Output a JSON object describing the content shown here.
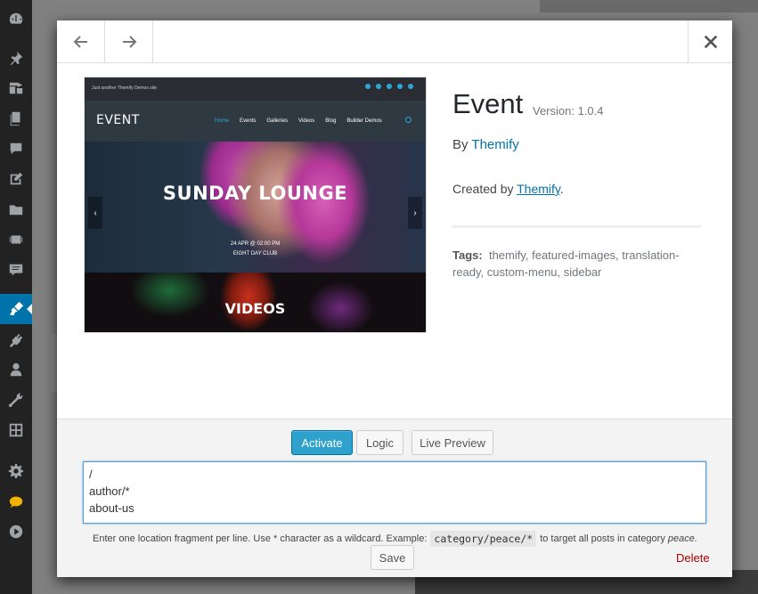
{
  "admin_menu": {
    "icons": [
      "dashboard-icon",
      "pin-icon",
      "media-icon",
      "pages-icon",
      "comments-icon",
      "edit-icon",
      "folder-icon",
      "slider-icon",
      "feedback-icon",
      "appearance-icon",
      "plugins-icon",
      "users-icon",
      "tools-icon",
      "settings-grid-icon",
      "gear-icon",
      "bubble-icon",
      "play-icon"
    ]
  },
  "modal": {
    "header": {
      "prev_icon": "arrow-left-icon",
      "next_icon": "arrow-right-icon",
      "close_icon": "close-icon"
    },
    "screenshot": {
      "tagline": "Just another Themify Demos site",
      "logo": "EVENT",
      "menu": [
        "Home",
        "Events",
        "Galleries",
        "Videos",
        "Blog",
        "Builder Demos"
      ],
      "hero_title": "SUNDAY LOUNGE",
      "hero_date": "24 APR @ 02:00 PM",
      "hero_venue": "EIGHT DAY CLUB",
      "videos_title": "VIDEOS"
    },
    "theme": {
      "name": "Event",
      "version": "Version: 1.0.4",
      "by_prefix": "By",
      "author": "Themify",
      "created_prefix": "Created by",
      "created_author": "Themify",
      "created_suffix": ".",
      "tags_label": "Tags:",
      "tags": "themify, featured-images, translation-ready, custom-menu, sidebar"
    },
    "footer": {
      "activate_label": "Activate",
      "logic_label": "Logic",
      "live_preview_label": "Live Preview",
      "logic_text": "/\nauthor/*\nabout-us",
      "hint_before": "Enter one location fragment per line. Use * character as a wildcard. Example:",
      "hint_code": "category/peace/*",
      "hint_after": "to target all posts in category",
      "hint_emphasis": "peace.",
      "save_label": "Save",
      "delete_label": "Delete"
    }
  },
  "colors": {
    "primary": "#2ea2cc",
    "link": "#0073aa",
    "delete": "#aa0000",
    "admin_bg": "#222222"
  }
}
